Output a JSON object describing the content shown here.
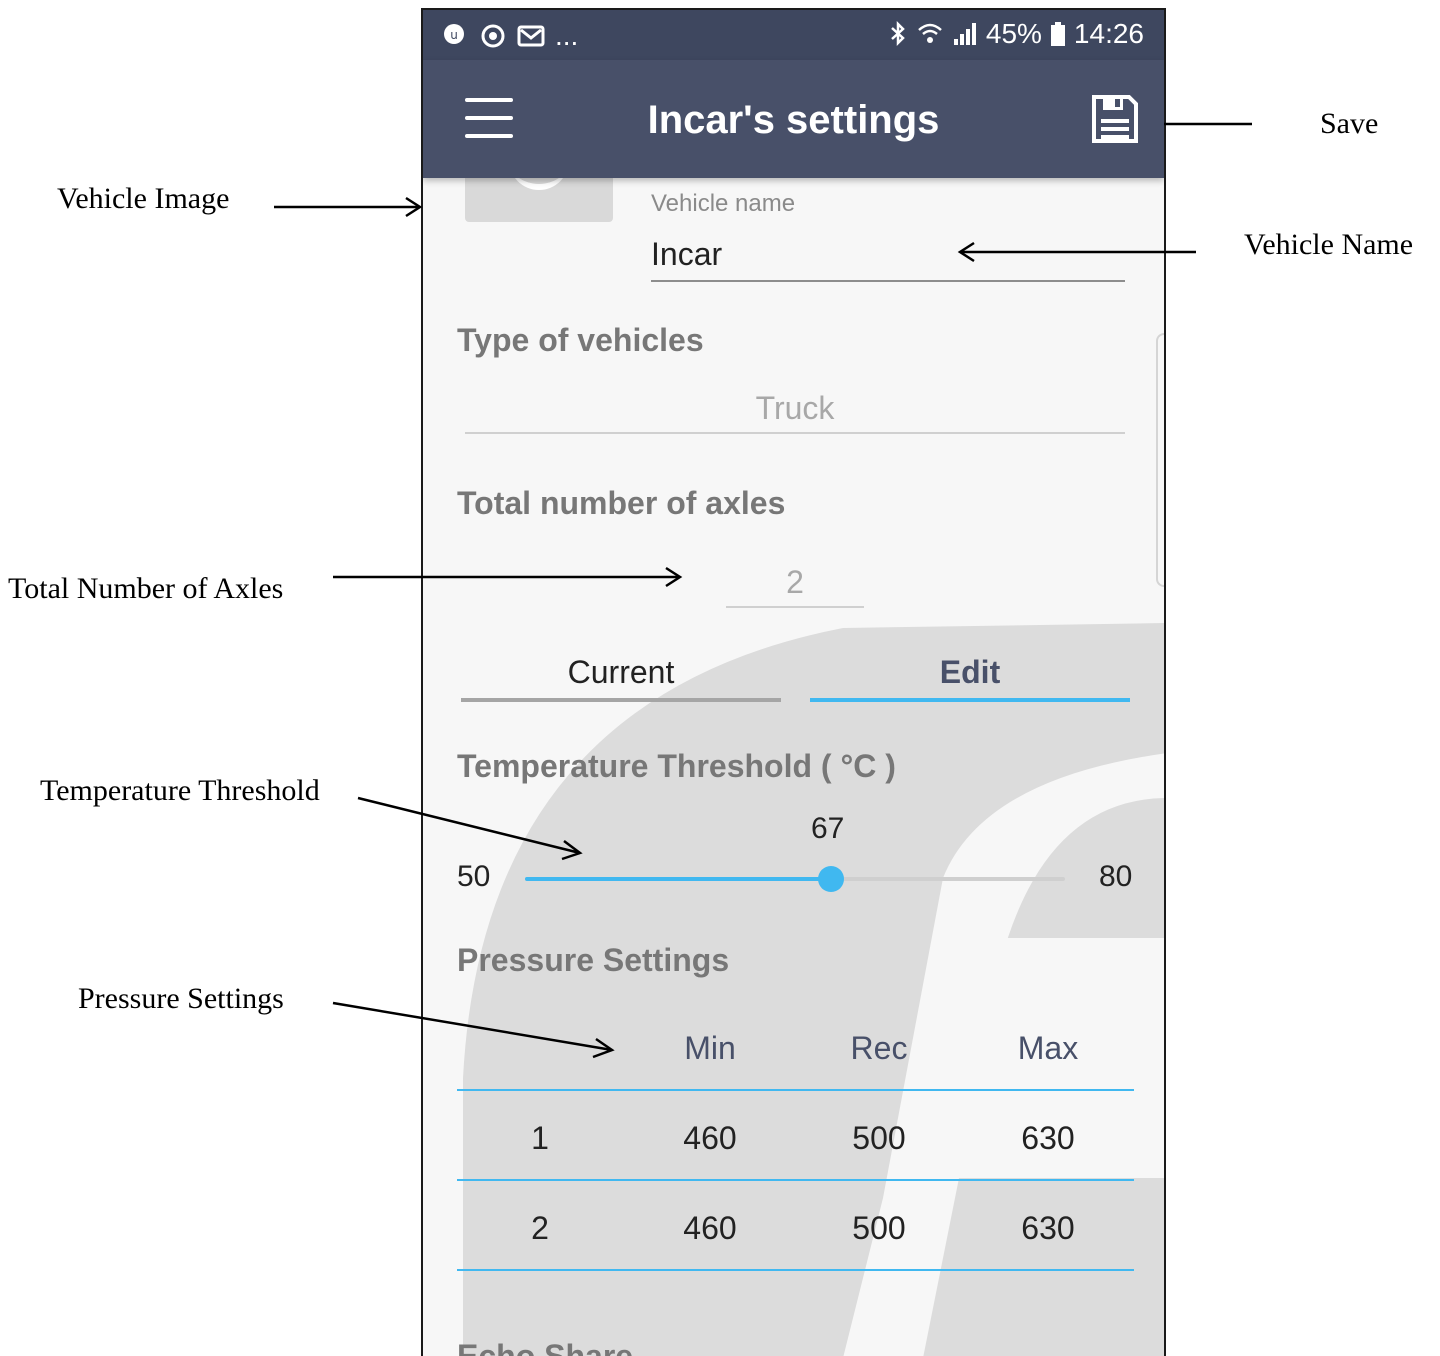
{
  "statusbar": {
    "left_icons": [
      "ultra-app-icon",
      "sync-icon",
      "mail-icon"
    ],
    "more": "...",
    "battery": "45%",
    "time": "14:26",
    "right_icons": [
      "bluetooth-icon",
      "wifi-icon",
      "signal-icon",
      "battery-icon"
    ]
  },
  "appbar": {
    "title": "Incar's settings",
    "menu_icon": "hamburger-menu-icon",
    "save_icon": "floppy-save-icon",
    "color": "#485069"
  },
  "vehicle": {
    "name_label": "Vehicle name",
    "name_value": "Incar"
  },
  "type_section": {
    "title": "Type of vehicles",
    "value": "Truck"
  },
  "axles_section": {
    "title": "Total number of axles",
    "value": "2"
  },
  "tabs": [
    {
      "label": "Current",
      "active": false
    },
    {
      "label": "Edit",
      "active": true
    }
  ],
  "temperature": {
    "title": "Temperature Threshold ( °C )",
    "min": "50",
    "max": "80",
    "value": "67",
    "accent": "#40b8f0"
  },
  "pressure": {
    "title": "Pressure Settings",
    "headers": [
      "Min",
      "Rec",
      "Max"
    ],
    "rows": [
      {
        "axle": "1",
        "min": "460",
        "rec": "500",
        "max": "630"
      },
      {
        "axle": "2",
        "min": "460",
        "rec": "500",
        "max": "630"
      }
    ]
  },
  "next_section_partial": "Echo Share",
  "annotations": {
    "save": "Save",
    "vehicle_image": "Vehicle Image",
    "vehicle_name": "Vehicle Name",
    "total_axles": "Total Number of Axles",
    "temperature": "Temperature Threshold",
    "pressure": "Pressure Settings"
  }
}
